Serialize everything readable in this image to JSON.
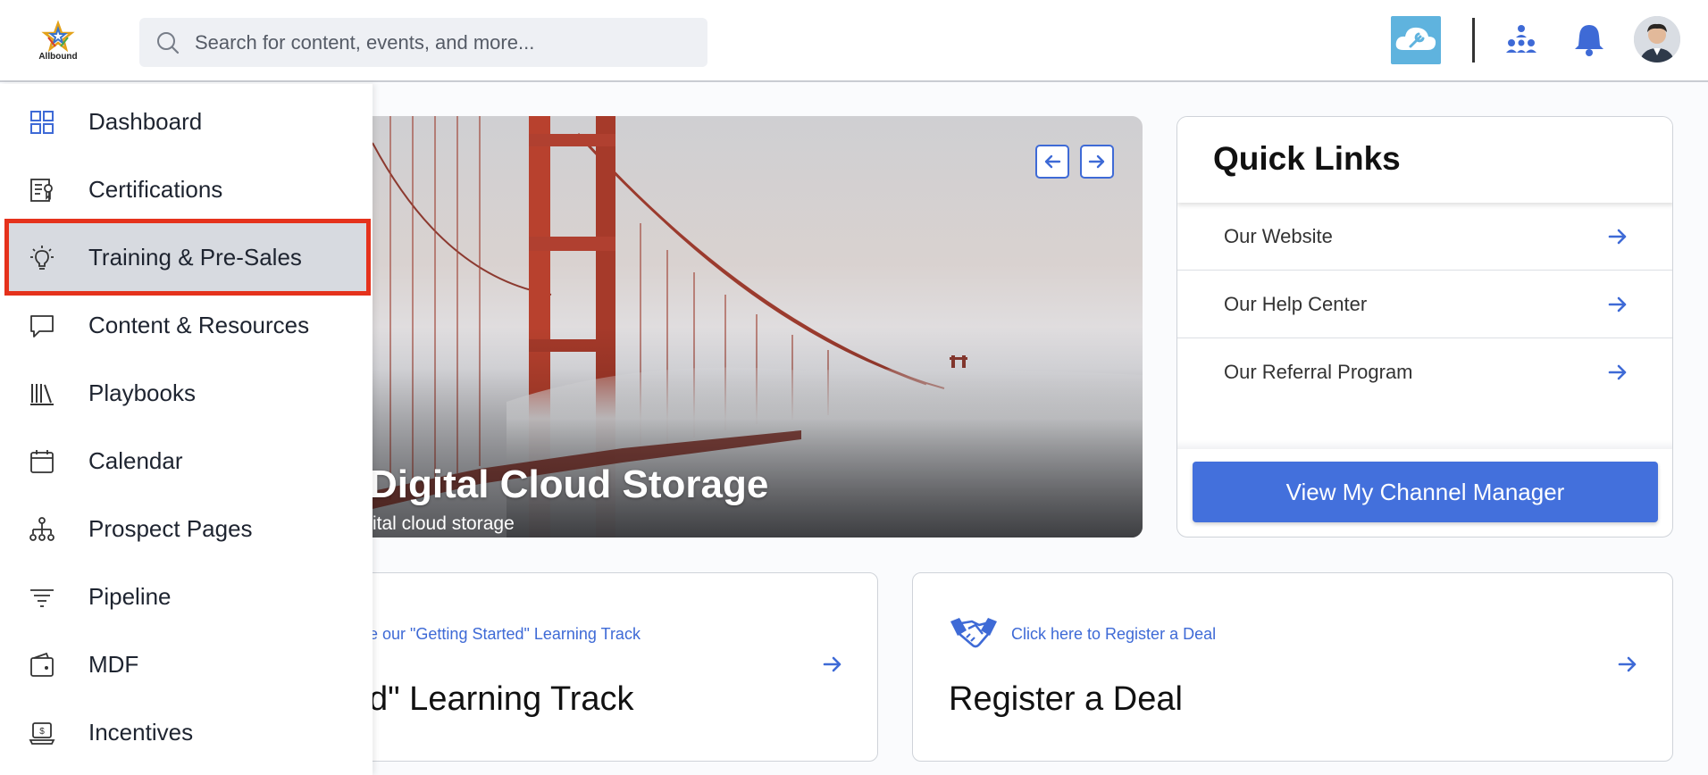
{
  "brand": {
    "logo_text": "Allbound"
  },
  "search": {
    "placeholder": "Search for content, events, and more..."
  },
  "header_icons": [
    "cloud-wrench-icon",
    "team-icon",
    "bell-icon",
    "user-avatar"
  ],
  "sidebar": {
    "items": [
      {
        "label": "Dashboard",
        "icon": "grid-icon",
        "active": false
      },
      {
        "label": "Certifications",
        "icon": "certificate-icon",
        "active": false
      },
      {
        "label": "Training & Pre-Sales",
        "icon": "lightbulb-icon",
        "active": true
      },
      {
        "label": "Content & Resources",
        "icon": "chat-bubble-icon",
        "active": false
      },
      {
        "label": "Playbooks",
        "icon": "books-icon",
        "active": false
      },
      {
        "label": "Calendar",
        "icon": "calendar-icon",
        "active": false
      },
      {
        "label": "Prospect Pages",
        "icon": "hierarchy-icon",
        "active": false
      },
      {
        "label": "Pipeline",
        "icon": "filter-lines-icon",
        "active": false
      },
      {
        "label": "MDF",
        "icon": "wallet-icon",
        "active": false
      },
      {
        "label": "Incentives",
        "icon": "laptop-dollar-icon",
        "active": false
      }
    ]
  },
  "hero": {
    "title": "Digital Cloud Storage",
    "subtitle": "ital cloud storage",
    "prev_icon": "arrow-left-icon",
    "next_icon": "arrow-right-icon"
  },
  "quick_links": {
    "title": "Quick Links",
    "items": [
      {
        "label": "Our Website"
      },
      {
        "label": "Our Help Center"
      },
      {
        "label": "Our Referral Program"
      }
    ],
    "cta": "View My Channel Manager"
  },
  "cards": [
    {
      "link": "e our \"Getting Started\" Learning Track",
      "title": "d\" Learning Track"
    },
    {
      "link": "Click here to Register a Deal",
      "title": "Register a Deal",
      "icon": "handshake-icon"
    }
  ],
  "colors": {
    "accent": "#4370dc",
    "highlight_border": "#e5321c",
    "active_bg": "#d7dae0"
  }
}
